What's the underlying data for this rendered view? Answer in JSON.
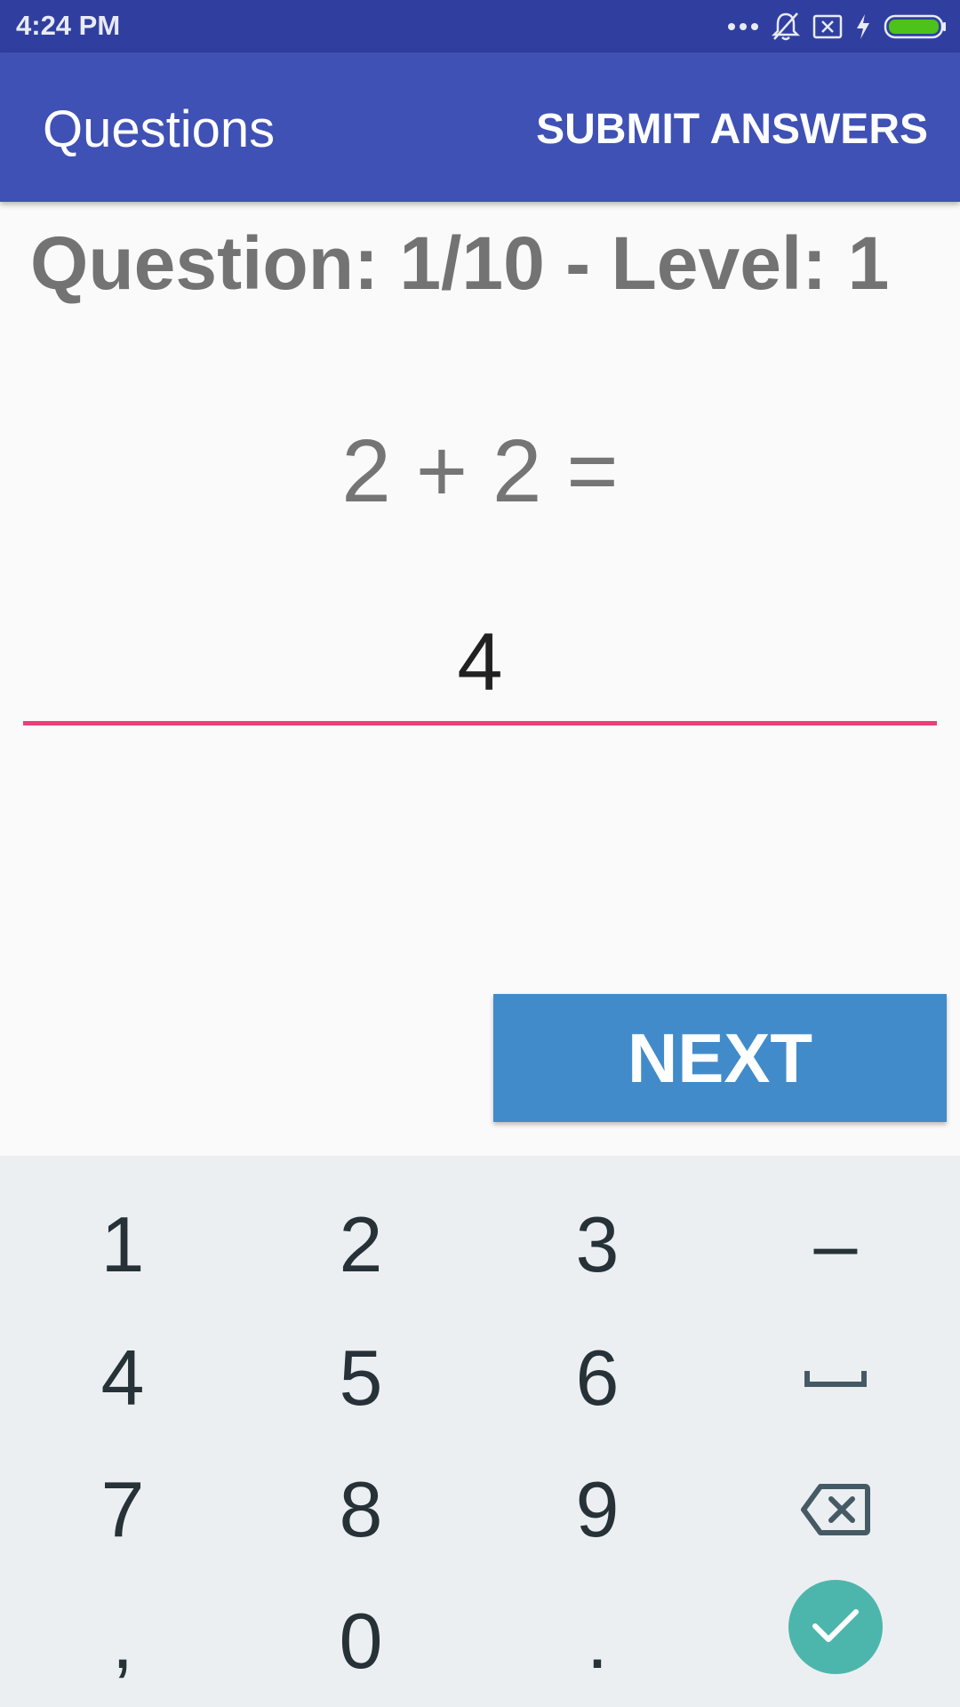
{
  "status_bar": {
    "time": "4:24 PM",
    "icons": [
      "more-dots-icon",
      "bell-off-icon",
      "sim-x-icon",
      "charging-bolt-icon",
      "battery-icon"
    ],
    "battery_color": "#4cc21a"
  },
  "app_bar": {
    "title": "Questions",
    "action_label": "SUBMIT ANSWERS",
    "color": "#3f51b5"
  },
  "quiz": {
    "header": "Question: 1/10 - Level: 1",
    "problem": "2 + 2 =",
    "answer_value": "4",
    "underline_color": "#ec407a"
  },
  "next_button": {
    "label": "NEXT",
    "color": "#428bca"
  },
  "keyboard": {
    "row1": [
      "1",
      "2",
      "3",
      "–"
    ],
    "row2": [
      "4",
      "5",
      "6"
    ],
    "row3": [
      "7",
      "8",
      "9"
    ],
    "row4": [
      ",",
      "0",
      "."
    ],
    "special_keys": [
      "space-key-icon",
      "backspace-icon",
      "done-check-icon"
    ],
    "done_color": "#4db6ac"
  }
}
